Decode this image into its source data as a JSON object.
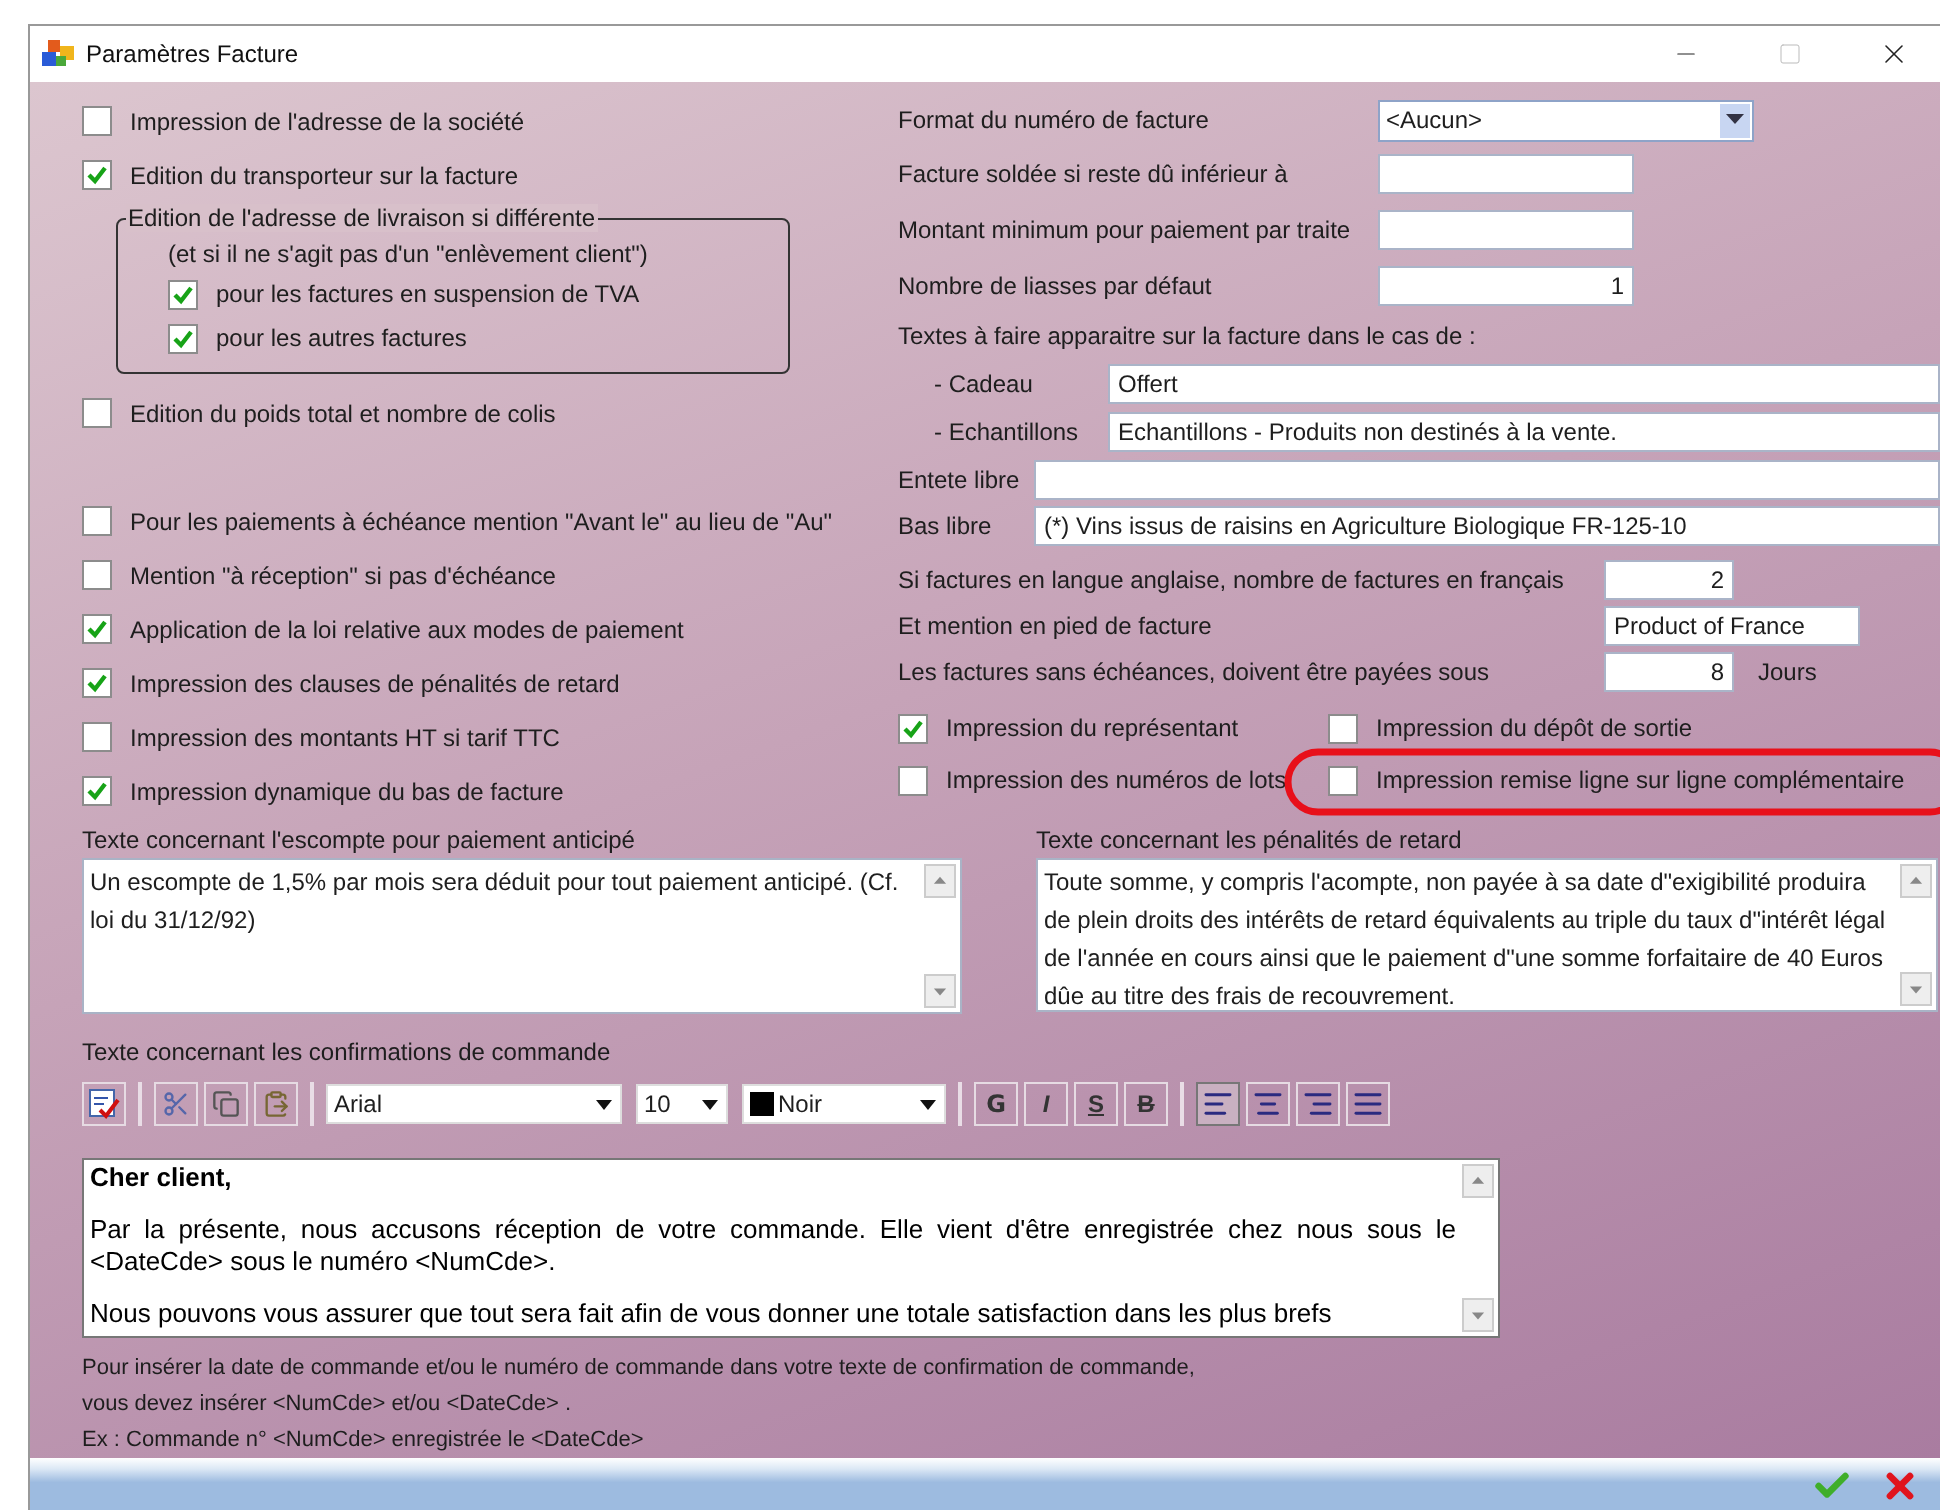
{
  "window": {
    "title": "Paramètres Facture"
  },
  "general_options": [
    {
      "kind": "checkbox",
      "label": "Impression de l'adresse de la société",
      "checked": false
    },
    {
      "kind": "checkbox",
      "label": "Edition du transporteur sur la facture",
      "checked": true
    },
    {
      "kind": "group",
      "title": "Edition de l'adresse de livraison si différente",
      "note": "(et si il ne s'agit pas d'un \"enlèvement client\")",
      "items": [
        {
          "label": "pour les factures en suspension de TVA",
          "checked": true
        },
        {
          "label": "pour les autres factures",
          "checked": true
        }
      ]
    },
    {
      "kind": "checkbox",
      "label": "Edition du poids total et nombre de colis",
      "checked": false
    }
  ],
  "payment_options": [
    {
      "label": "Pour les paiements à échéance mention \"Avant le\" au lieu de \"Au\"",
      "checked": false
    },
    {
      "label": "Mention \"à réception\" si pas d'échéance",
      "checked": false
    },
    {
      "label": "Application de la loi relative aux modes de paiement",
      "checked": true
    },
    {
      "label": "Impression des clauses de pénalités de retard",
      "checked": true
    },
    {
      "label": "Impression des montants HT si tarif TTC",
      "checked": false
    },
    {
      "label": "Impression dynamique du bas de facture",
      "checked": true
    }
  ],
  "invoice_settings": [
    {
      "kind": "select",
      "label": "Format du numéro de facture",
      "value": "<Aucun>"
    },
    {
      "kind": "text",
      "label": "Facture soldée si reste dû inférieur à"
    },
    {
      "kind": "text",
      "label": "Montant minimum pour paiement par traite"
    },
    {
      "kind": "number",
      "label": "Nombre de liasses par défaut",
      "value": "1"
    }
  ],
  "invoice_texts": {
    "heading": "Textes à faire apparaitre sur la facture dans le cas de :",
    "rows": [
      {
        "label": "- Cadeau",
        "value": "Offert"
      },
      {
        "label": "- Echantillons",
        "value": "Echantillons - Produits non destinés à la vente."
      }
    ]
  },
  "free_texts": [
    {
      "label": "Entete libre"
    },
    {
      "label": "Bas libre",
      "value": "(*) Vins issus de raisins en Agriculture Biologique FR-125-10"
    }
  ],
  "language_settings": [
    {
      "kind": "number",
      "label": "Si factures en langue anglaise, nombre de factures en français",
      "value": "2"
    },
    {
      "kind": "text",
      "label": "Et mention en pied de facture",
      "value": "Product of France"
    },
    {
      "kind": "number",
      "label": "Les factures sans échéances, doivent être payées sous",
      "value": "8",
      "unit": "Jours"
    }
  ],
  "print_options": [
    {
      "label": "Impression du représentant",
      "checked": true
    },
    {
      "label": "Impression du dépôt de sortie",
      "checked": false
    },
    {
      "label": "Impression des numéros de lots",
      "checked": false
    },
    {
      "label": "Impression remise ligne sur ligne complémentaire",
      "checked": false
    }
  ],
  "discount_text": {
    "label": "Texte concernant l'escompte pour paiement anticipé",
    "value": "Un escompte de 1,5% par mois sera déduit pour tout paiement anticipé. (Cf. loi du 31/12/92)"
  },
  "penalty_text": {
    "label": "Texte concernant les pénalités de retard",
    "value": "Toute somme, y compris l'acompte, non payée à sa date d\"exigibilité produira de plein droits des intérêts de retard équivalents au triple du taux d\"intérêt légal de l'année en cours ainsi que le paiement d\"une somme forfaitaire de 40 Euros dûe au titre des frais de recouvrement."
  },
  "confirmation": {
    "label": "Texte concernant les confirmations de commande",
    "font": "Arial",
    "size": "10",
    "color_name": "Noir",
    "format_buttons": [
      {
        "label": "G",
        "kind": "bold"
      },
      {
        "label": "I",
        "kind": "italic"
      },
      {
        "label": "S",
        "kind": "underline"
      },
      {
        "label": "B",
        "kind": "strike"
      }
    ],
    "alignment_buttons": [
      {
        "kind": "left",
        "selected": true
      },
      {
        "kind": "center",
        "selected": false
      },
      {
        "kind": "right",
        "selected": false
      },
      {
        "kind": "justify",
        "selected": false
      }
    ],
    "paragraphs": [
      {
        "kind": "greeting",
        "text": "Cher client,"
      },
      {
        "kind": "body",
        "text": "Par la présente, nous accusons réception de votre commande. Elle vient d'être enregistrée chez nous sous le <DateCde> sous le numéro <NumCde>."
      },
      {
        "kind": "body",
        "text": "Nous pouvons vous assurer que tout sera fait afin de vous donner une totale satisfaction dans les plus brefs"
      }
    ],
    "help": [
      "Pour insérer la date de commande et/ou le numéro de commande dans votre texte de confirmation de commande, vous devez insérer <NumCde> et/ou <DateCde> .",
      "Ex : Commande n° <NumCde> enregistrée le <DateCde>"
    ]
  }
}
